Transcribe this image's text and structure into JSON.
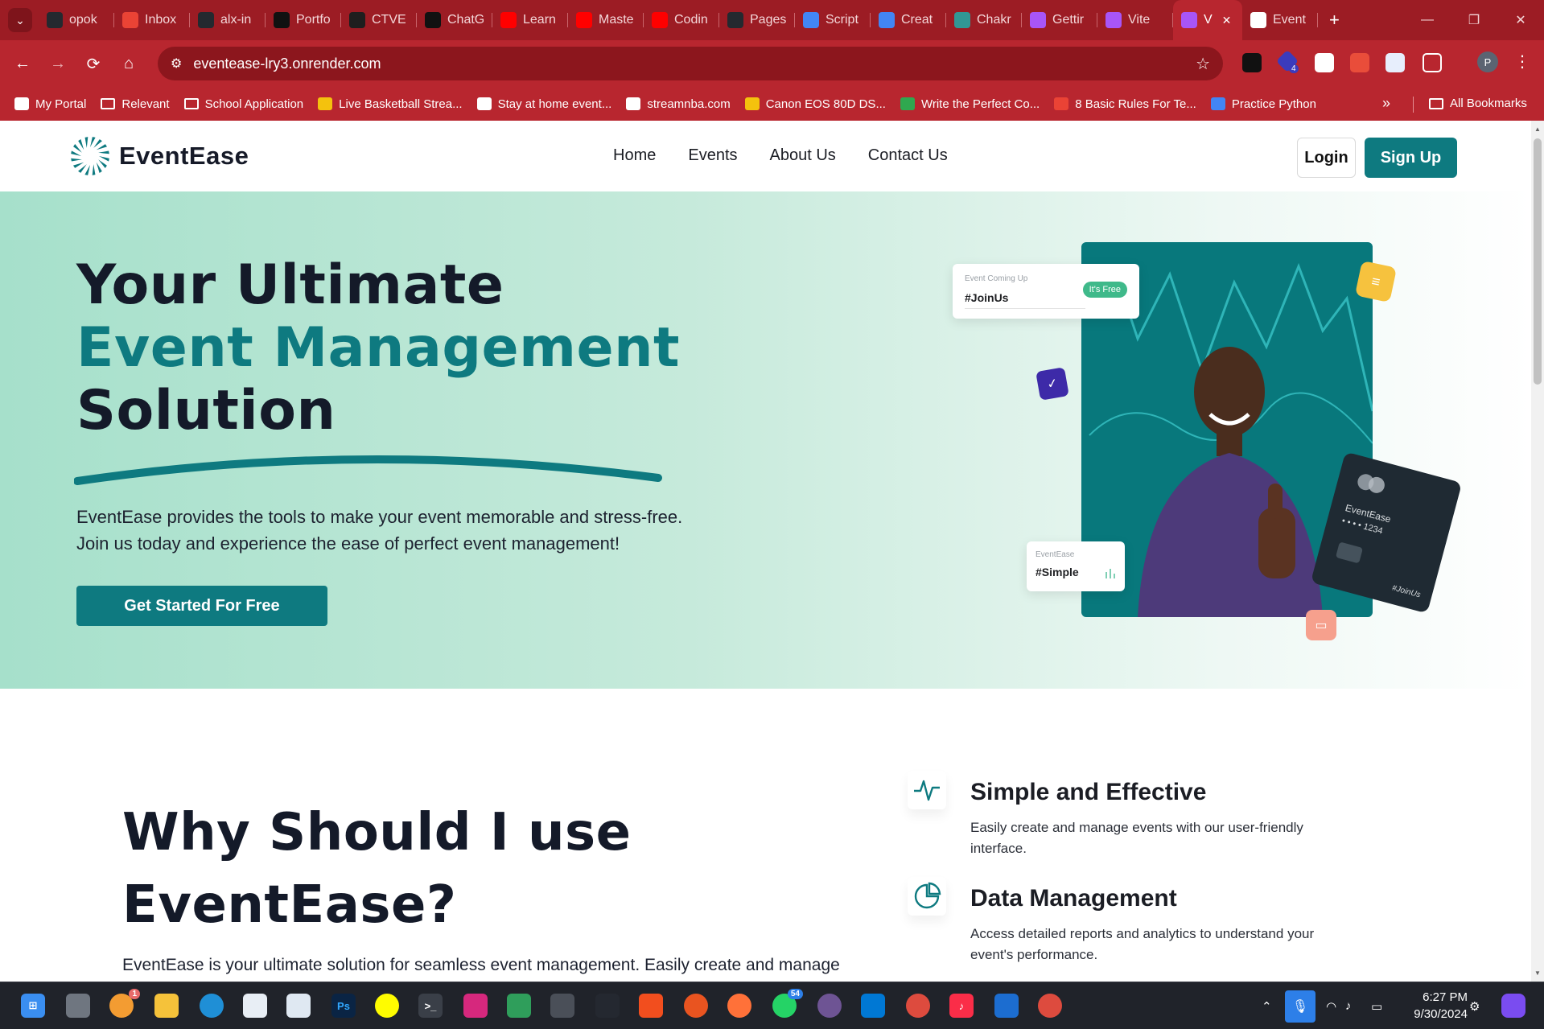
{
  "browser": {
    "tabs": [
      {
        "title": "opok",
        "icon": "github-icon",
        "color": "#24292f"
      },
      {
        "title": "Inbox",
        "icon": "gmail-icon",
        "color": "#ea4335"
      },
      {
        "title": "alx-in",
        "icon": "github-icon",
        "color": "#24292f"
      },
      {
        "title": "Portfo",
        "icon": "play-icon",
        "color": "#111111"
      },
      {
        "title": "CTVE",
        "icon": "ctve-icon",
        "color": "#1e1e1e"
      },
      {
        "title": "ChatG",
        "icon": "chatgpt-icon",
        "color": "#111111"
      },
      {
        "title": "Learn",
        "icon": "youtube-icon",
        "color": "#ff0000"
      },
      {
        "title": "Maste",
        "icon": "youtube-icon",
        "color": "#ff0000"
      },
      {
        "title": "Codin",
        "icon": "youtube-icon",
        "color": "#ff0000"
      },
      {
        "title": "Pages",
        "icon": "github-icon",
        "color": "#24292f"
      },
      {
        "title": "Script",
        "icon": "docs-icon",
        "color": "#4285f4"
      },
      {
        "title": "Creat",
        "icon": "docs-icon",
        "color": "#4285f4"
      },
      {
        "title": "Chakr",
        "icon": "chakra-icon",
        "color": "#319795"
      },
      {
        "title": "Gettir",
        "icon": "vite-icon",
        "color": "#a855f7"
      },
      {
        "title": "Vite",
        "icon": "vite-icon",
        "color": "#a855f7"
      },
      {
        "title": "V",
        "icon": "vite-icon",
        "color": "#a855f7",
        "active": true
      },
      {
        "title": "Event",
        "icon": "eventease-icon",
        "color": "#ffffff"
      }
    ],
    "url": "eventease-lry3.onrender.com",
    "profile_initial": "P",
    "extension_badge": "4",
    "bookmarks": [
      {
        "label": "My Portal",
        "icon": "portal-icon"
      },
      {
        "label": "Relevant",
        "icon": "folder-icon"
      },
      {
        "label": "School Application",
        "icon": "folder-icon"
      },
      {
        "label": "Live Basketball Strea...",
        "icon": "24-icon"
      },
      {
        "label": "Stay at home event...",
        "icon": "site-icon"
      },
      {
        "label": "streamnba.com",
        "icon": "page-icon"
      },
      {
        "label": "Canon EOS 80D DS...",
        "icon": "coin-icon"
      },
      {
        "label": "Write the Perfect Co...",
        "icon": "doc-icon"
      },
      {
        "label": "8 Basic Rules For Te...",
        "icon": "stripes-icon"
      },
      {
        "label": "Practice Python",
        "icon": "chrome-icon"
      }
    ],
    "all_bookmarks": "All Bookmarks"
  },
  "site": {
    "brand": "EventEase",
    "nav": [
      "Home",
      "Events",
      "About Us",
      "Contact Us"
    ],
    "login": "Login",
    "signup": "Sign Up",
    "accent": "#0e7a80"
  },
  "hero": {
    "title_line1": "Your Ultimate",
    "title_line2": "Event Management",
    "title_line3": "Solution",
    "text_line1": "EventEase provides the tools to make your event memorable and stress-free.",
    "text_line2": "Join us today and experience the ease of perfect event management!",
    "cta": "Get Started For Free",
    "card_coming_label": "Event Coming Up",
    "card_coming_tag": "#JoinUs",
    "card_coming_pill": "It's Free",
    "card_simple_label": "EventEase",
    "card_simple_tag": "#Simple",
    "credit_brand": "EventEase",
    "credit_number": "• • • •  1234",
    "credit_hashtag": "#JoinUs"
  },
  "why": {
    "title_line1": "Why Should I use",
    "title_line2": "EventEase?",
    "text": "EventEase is your ultimate solution for seamless event management. Easily create and manage"
  },
  "features": [
    {
      "icon": "activity-icon",
      "title": "Simple and Effective",
      "text": "Easily create and manage events with our user-friendly interface."
    },
    {
      "icon": "pie-chart-icon",
      "title": "Data Management",
      "text": "Access detailed reports and analytics to understand your event's performance."
    }
  ],
  "taskbar": {
    "time": "6:27 PM",
    "date": "9/30/2024",
    "badges": {
      "weather": "1",
      "whatsapp": "54"
    }
  }
}
